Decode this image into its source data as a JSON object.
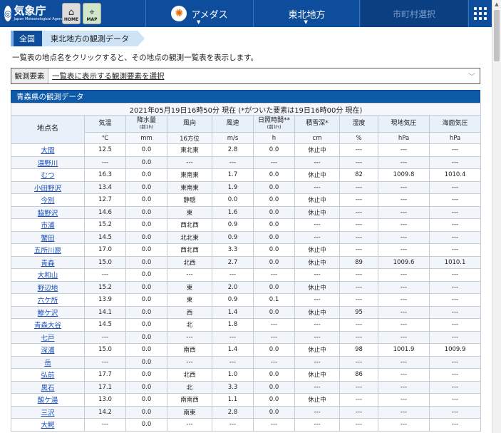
{
  "header": {
    "logo_jp": "気象庁",
    "logo_en": "Japan Meteorological Agency",
    "home_label": "HOME",
    "map_label": "MAP",
    "amedas_label": "アメダス",
    "area_label": "東北地方",
    "muni_label": "市町村選択"
  },
  "breadcrumb": {
    "level1": "全国",
    "level2": "東北地方の観測データ"
  },
  "instruction": "一覧表の地点名をクリックすると、その地点の観測一覧表を表示します。",
  "element_select": {
    "label": "観測要素",
    "value": "一覧表に表示する観測要素を選択"
  },
  "table": {
    "title": "青森県の観測データ",
    "timestamp": "2021年05月19日16時50分 現在 (*がついた要素は19日16時00分 現在)",
    "columns": [
      {
        "label": "地点名",
        "sub": "",
        "unit": ""
      },
      {
        "label": "気温",
        "sub": "",
        "unit": "℃"
      },
      {
        "label": "降水量",
        "sub": "(前1h)",
        "unit": "mm"
      },
      {
        "label": "風向",
        "sub": "",
        "unit": "16方位"
      },
      {
        "label": "風速",
        "sub": "",
        "unit": "m/s"
      },
      {
        "label": "日照時間**",
        "sub": "(前1h)",
        "unit": "h"
      },
      {
        "label": "積雪深*",
        "sub": "",
        "unit": "cm"
      },
      {
        "label": "湿度",
        "sub": "",
        "unit": "%"
      },
      {
        "label": "現地気圧",
        "sub": "",
        "unit": "hPa"
      },
      {
        "label": "海面気圧",
        "sub": "",
        "unit": "hPa"
      }
    ],
    "rows": [
      [
        "大間",
        "12.5",
        "0.0",
        "東北東",
        "2.8",
        "0.0",
        "休止中",
        "---",
        "---",
        "---"
      ],
      [
        "湯野川",
        "---",
        "0.0",
        "---",
        "---",
        "---",
        "---",
        "---",
        "---",
        "---"
      ],
      [
        "むつ",
        "16.3",
        "0.0",
        "東南東",
        "1.7",
        "0.0",
        "休止中",
        "82",
        "1009.8",
        "1010.4"
      ],
      [
        "小田野沢",
        "13.4",
        "0.0",
        "東南東",
        "1.9",
        "0.0",
        "---",
        "---",
        "---",
        "---"
      ],
      [
        "今別",
        "12.7",
        "0.0",
        "静穏",
        "0.0",
        "0.0",
        "休止中",
        "---",
        "---",
        "---"
      ],
      [
        "脇野沢",
        "14.6",
        "0.0",
        "東",
        "1.6",
        "0.0",
        "休止中",
        "---",
        "---",
        "---"
      ],
      [
        "市浦",
        "15.2",
        "0.0",
        "西北西",
        "0.9",
        "0.0",
        "---",
        "---",
        "---",
        "---"
      ],
      [
        "蟹田",
        "14.5",
        "0.0",
        "北北東",
        "0.9",
        "0.0",
        "---",
        "---",
        "---",
        "---"
      ],
      [
        "五所川原",
        "17.0",
        "0.0",
        "西北西",
        "3.3",
        "0.0",
        "休止中",
        "---",
        "---",
        "---"
      ],
      [
        "青森",
        "15.0",
        "0.0",
        "北西",
        "2.7",
        "0.0",
        "休止中",
        "89",
        "1009.6",
        "1010.1"
      ],
      [
        "大和山",
        "---",
        "0.0",
        "---",
        "---",
        "---",
        "---",
        "---",
        "---",
        "---"
      ],
      [
        "野辺地",
        "15.2",
        "0.0",
        "東",
        "2.0",
        "0.0",
        "休止中",
        "---",
        "---",
        "---"
      ],
      [
        "六ケ所",
        "13.9",
        "0.0",
        "東",
        "0.9",
        "0.1",
        "---",
        "---",
        "---",
        "---"
      ],
      [
        "鰺ケ沢",
        "14.1",
        "0.0",
        "西",
        "1.4",
        "0.0",
        "休止中",
        "95",
        "---",
        "---"
      ],
      [
        "青森大谷",
        "14.5",
        "0.0",
        "北",
        "1.8",
        "---",
        "---",
        "---",
        "---",
        "---"
      ],
      [
        "七戸",
        "---",
        "0.0",
        "---",
        "---",
        "---",
        "---",
        "---",
        "---",
        "---"
      ],
      [
        "深浦",
        "15.0",
        "0.0",
        "南西",
        "1.4",
        "0.0",
        "休止中",
        "98",
        "1001.9",
        "1009.9"
      ],
      [
        "岳",
        "---",
        "0.0",
        "---",
        "---",
        "---",
        "---",
        "---",
        "---",
        "---"
      ],
      [
        "弘前",
        "17.7",
        "0.0",
        "北西",
        "1.0",
        "0.0",
        "休止中",
        "86",
        "---",
        "---"
      ],
      [
        "黒石",
        "17.1",
        "0.0",
        "北",
        "3.3",
        "0.0",
        "---",
        "---",
        "---",
        "---"
      ],
      [
        "酸ケ湯",
        "13.0",
        "0.0",
        "南南西",
        "1.1",
        "0.0",
        "休止中",
        "---",
        "---",
        "---"
      ],
      [
        "三沢",
        "14.2",
        "0.0",
        "南東",
        "2.8",
        "0.0",
        "---",
        "---",
        "---",
        "---"
      ],
      [
        "大鰐",
        "---",
        "0.0",
        "---",
        "---",
        "---",
        "---",
        "---",
        "---",
        "---"
      ]
    ]
  }
}
